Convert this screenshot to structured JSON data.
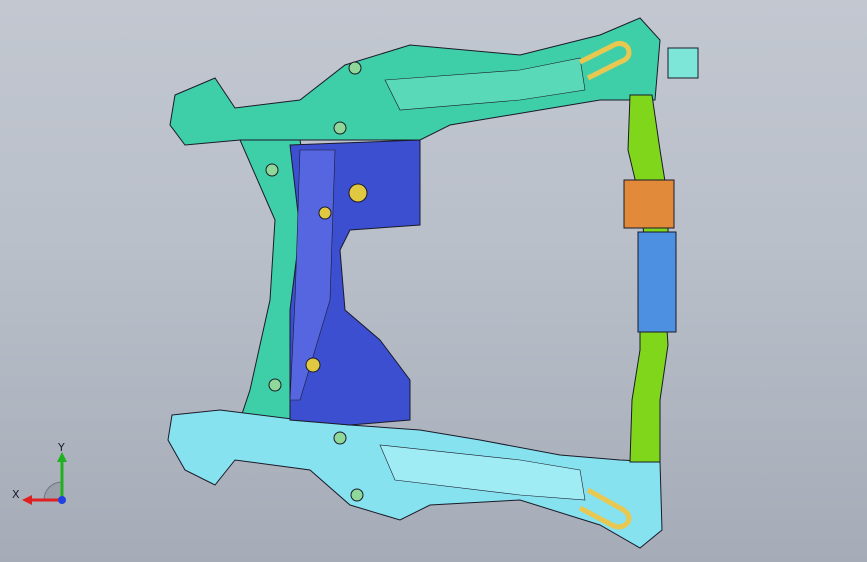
{
  "viewport": {
    "background_top": "#c2c7d0",
    "background_bottom": "#a6acb7"
  },
  "model": {
    "name_icon": "subframe-3d-model",
    "colors": {
      "teal_frame": "#3fcfa8",
      "light_teal": "#7ee6d8",
      "cyan_arm": "#86e2ef",
      "blue_plate": "#3c4fd0",
      "green_tube": "#7fd61a",
      "blue_bracket": "#4d8fe0",
      "orange_bracket": "#e08a3a",
      "edge": "#1a1a2a"
    }
  },
  "triad": {
    "x_label": "X",
    "y_label": "Y",
    "x_color": "#e02020",
    "y_color": "#20b020",
    "z_color": "#2040e0"
  }
}
